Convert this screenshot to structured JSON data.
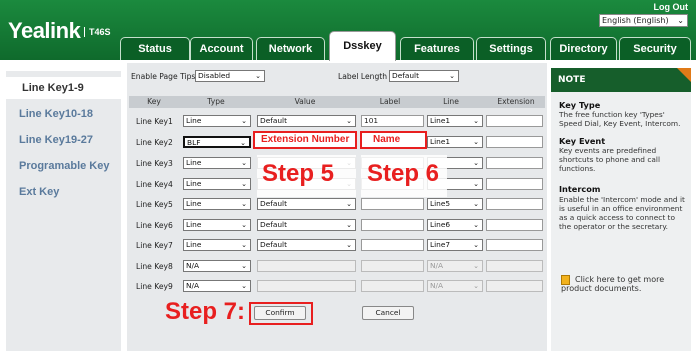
{
  "header": {
    "logo": "Yealink",
    "model": "T46S",
    "logout": "Log Out",
    "language": "English (English)",
    "tabs": [
      "Status",
      "Account",
      "Network",
      "Dsskey",
      "Features",
      "Settings",
      "Directory",
      "Security"
    ],
    "active_tab": "Dsskey"
  },
  "sidebar": {
    "items": [
      "Line Key1-9",
      "Line Key10-18",
      "Line Key19-27",
      "Programable Key",
      "Ext Key"
    ],
    "active": "Line Key1-9"
  },
  "form": {
    "page_tips_label": "Enable Page Tips",
    "page_tips_value": "Disabled",
    "label_length_label": "Label Length",
    "label_length_value": "Default",
    "columns": [
      "Key",
      "Type",
      "Value",
      "Label",
      "Line",
      "Extension"
    ],
    "rows": [
      {
        "key": "Line Key1",
        "type": "Line",
        "value": "Default",
        "label": "101",
        "line": "Line1",
        "ext": ""
      },
      {
        "key": "Line Key2",
        "type": "BLF",
        "value": "",
        "label": "",
        "line": "Line1",
        "ext": ""
      },
      {
        "key": "Line Key3",
        "type": "Line",
        "value": "",
        "label": "",
        "line": "",
        "ext": ""
      },
      {
        "key": "Line Key4",
        "type": "Line",
        "value": "",
        "label": "",
        "line": "",
        "ext": ""
      },
      {
        "key": "Line Key5",
        "type": "Line",
        "value": "Default",
        "label": "",
        "line": "Line5",
        "ext": ""
      },
      {
        "key": "Line Key6",
        "type": "Line",
        "value": "Default",
        "label": "",
        "line": "Line6",
        "ext": ""
      },
      {
        "key": "Line Key7",
        "type": "Line",
        "value": "Default",
        "label": "",
        "line": "Line7",
        "ext": ""
      },
      {
        "key": "Line Key8",
        "type": "N/A",
        "value": "",
        "label": "",
        "line": "N/A",
        "ext": ""
      },
      {
        "key": "Line Key9",
        "type": "N/A",
        "value": "",
        "label": "",
        "line": "N/A",
        "ext": ""
      }
    ],
    "confirm": "Confirm",
    "cancel": "Cancel"
  },
  "annotations": {
    "extension_number": "Extension Number",
    "name": "Name",
    "step5": "Step 5",
    "step6": "Step 6",
    "step7": "Step 7:"
  },
  "note": {
    "title": "NOTE",
    "key_type_title": "Key Type",
    "key_type_text": "The free function key 'Types' Speed Dial, Key Event, Intercom.",
    "key_event_title": "Key Event",
    "key_event_text": "Key events are predefined shortcuts to phone and call functions.",
    "intercom_title": "Intercom",
    "intercom_text": "Enable the 'Intercom' mode and it is useful in an office environment as a quick access to connect to the operator or the secretary.",
    "docs_text": "Click here to get more product documents."
  },
  "colors": {
    "header_green": "#12783a",
    "note_green": "#165e2b",
    "annotation_red": "#e81f1f",
    "note_corner": "#e07a18"
  }
}
